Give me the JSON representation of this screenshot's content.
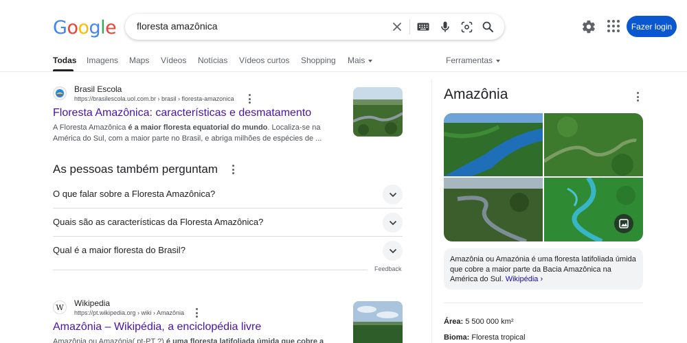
{
  "header": {
    "logo_letters": [
      {
        "char": "G",
        "color": "#4285F4"
      },
      {
        "char": "o",
        "color": "#EA4335"
      },
      {
        "char": "o",
        "color": "#FBBC05"
      },
      {
        "char": "g",
        "color": "#4285F4"
      },
      {
        "char": "l",
        "color": "#34A853"
      },
      {
        "char": "e",
        "color": "#EA4335"
      }
    ],
    "search_query": "floresta amazônica",
    "search_icons": [
      "clear-icon",
      "keyboard-icon",
      "microphone-icon",
      "lens-icon",
      "search-icon"
    ],
    "settings_icon": "gear-icon",
    "apps_icon": "apps-grid-icon",
    "login_label": "Fazer login",
    "accent": "#0b57d0"
  },
  "tabs": {
    "items": [
      "Todas",
      "Imagens",
      "Maps",
      "Vídeos",
      "Notícias",
      "Vídeos curtos",
      "Shopping"
    ],
    "more": "Mais",
    "tools": "Ferramentas",
    "active": "Todas"
  },
  "results": [
    {
      "site": "Brasil Escola",
      "url": "https://brasilescola.uol.com.br › brasil › floresta-amazonica",
      "title": "Floresta Amazônica: características e desmatamento",
      "snippet_pre": "A Floresta Amazônica ",
      "snippet_bold": "é a maior floresta equatorial do mundo",
      "snippet_post": ". Localiza-se na América do Sul, com a maior parte no Brasil, e abriga milhões de espécies de ..."
    },
    {
      "site": "Wikipedia",
      "url": "https://pt.wikipedia.org › wiki › Amazônia",
      "title": "Amazônia – Wikipédia, a enciclopédia livre",
      "snippet_pre": "Amazônia ou Amazónia( pt-PT ?) ",
      "snippet_bold": "é uma floresta latifoliada úmida que cobre a",
      "snippet_post": ""
    }
  ],
  "paa": {
    "title": "As pessoas também perguntam",
    "questions": [
      "O que falar sobre a Floresta Amazônica?",
      "Quais são as características da Floresta Amazônica?",
      "Qual é a maior floresta do Brasil?"
    ],
    "feedback": "Feedback"
  },
  "knowledge_panel": {
    "title": "Amazônia",
    "description": "Amazônia ou Amazónia é uma floresta latifoliada úmida que cobre a maior parte da Bacia Amazônica na América do Sul.",
    "source_link": "Wikipédia ›",
    "facts": [
      {
        "label": "Área:",
        "value": "5 500 000 km²"
      },
      {
        "label": "Bioma:",
        "value": "Floresta tropical"
      }
    ]
  }
}
